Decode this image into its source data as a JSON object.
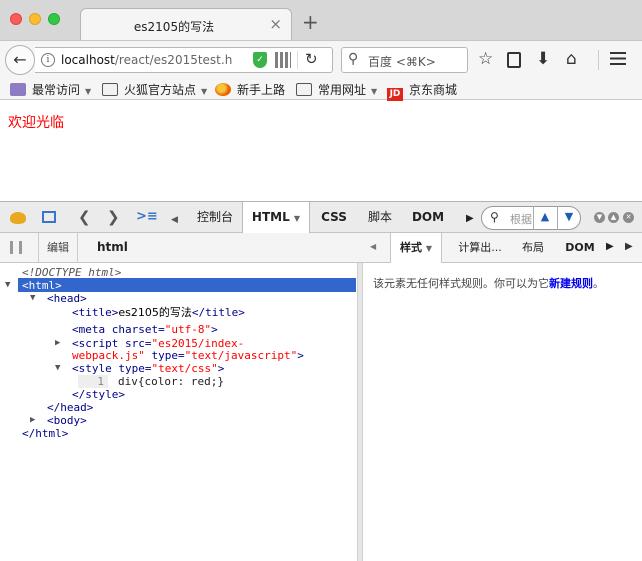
{
  "browser": {
    "tab_title": "es2105的写法",
    "tab_close": "×",
    "new_tab": "+",
    "url_host": "localhost",
    "url_path": "/react/es2015test.h",
    "search_placeholder": "百度 <⌘K>"
  },
  "bookmarks": [
    {
      "label": "最常访问",
      "icon": "star-folder-icon"
    },
    {
      "label": "火狐官方站点",
      "icon": "folder-icon"
    },
    {
      "label": "新手上路",
      "icon": "firefox-icon"
    },
    {
      "label": "常用网址",
      "icon": "folder-icon"
    },
    {
      "label": "京东商城",
      "icon": "jd-icon",
      "icon_text": "JD"
    }
  ],
  "page": {
    "welcome": "欢迎光临",
    "welcome_color": "#ff0000"
  },
  "devtools": {
    "tabs": [
      "控制台",
      "HTML",
      "CSS",
      "脚本",
      "DOM"
    ],
    "search_placeholder": "根据",
    "edit_label": "编辑",
    "breadcrumb": "html",
    "side_tabs": [
      "样式",
      "计算出...",
      "布局",
      "DOM"
    ],
    "style_empty": "该元素无任何样式规则。你可以为它",
    "style_link": "新建规则",
    "style_end": "。"
  },
  "html_tree": {
    "doctype": "<!DOCTYPE html>",
    "html_open": "<html>",
    "head_open": "<head>",
    "title_open": "<title>",
    "title_text": "es2105的写法",
    "title_close": "</title>",
    "meta_tag": "<meta",
    "meta_attr": "charset=",
    "meta_val": "\"utf-8\"",
    "meta_end": ">",
    "script_tag": "<script",
    "script_attr_src": "src=",
    "script_val_src_1": "\"es2015/index-",
    "script_val_src_2": "webpack.js\"",
    "script_attr_type": "type=",
    "script_val_type": "\"text/javascript\"",
    "script_end": ">",
    "style_tag": "<style",
    "style_attr": "type=",
    "style_val": "\"text/css\"",
    "style_end": ">",
    "style_line_no": "1",
    "style_content": "div{color: red;}",
    "style_close": "</style>",
    "head_close": "</head>",
    "body_tag": "<body>",
    "html_close": "</html>"
  },
  "colors": {
    "selection": "#3366cc",
    "tag": "#000088",
    "attr_value": "#ff0000"
  }
}
